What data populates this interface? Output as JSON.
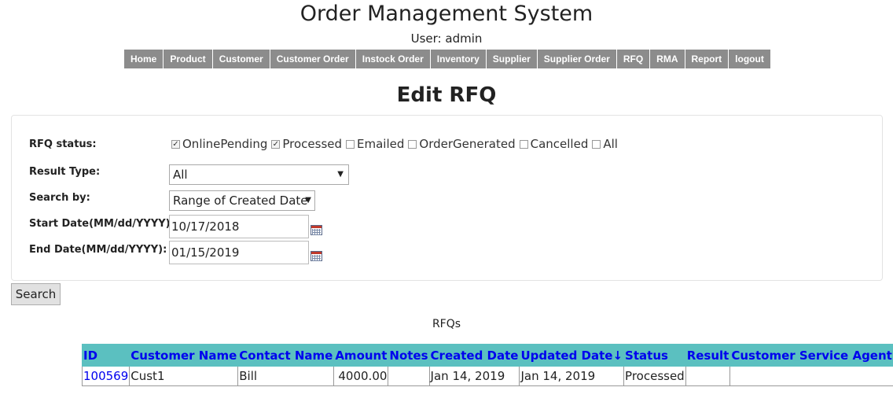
{
  "header": {
    "title": "Order Management System",
    "user_line": "User: admin"
  },
  "nav": {
    "items": [
      "Home",
      "Product",
      "Customer",
      "Customer Order",
      "Instock Order",
      "Inventory",
      "Supplier",
      "Supplier Order",
      "RFQ",
      "RMA",
      "Report",
      "logout"
    ]
  },
  "page": {
    "title": "Edit RFQ"
  },
  "form": {
    "status_label": "RFQ status:",
    "statuses": [
      {
        "label": "OnlinePending",
        "checked": true
      },
      {
        "label": "Processed",
        "checked": true
      },
      {
        "label": "Emailed",
        "checked": false
      },
      {
        "label": "OrderGenerated",
        "checked": false
      },
      {
        "label": "Cancelled",
        "checked": false
      },
      {
        "label": "All",
        "checked": false
      }
    ],
    "result_type_label": "Result Type:",
    "result_type_value": "All",
    "search_by_label": "Search by:",
    "search_by_value": "Range of Created Date",
    "start_date_label": "Start Date(MM/dd/YYYY):",
    "start_date_value": "10/17/2018",
    "end_date_label": "End Date(MM/dd/YYYY):",
    "end_date_value": "01/15/2019",
    "search_button": "Search",
    "dropdown_arrow": "▼"
  },
  "results": {
    "caption": "RFQs",
    "columns": [
      "ID",
      "Customer Name",
      "Contact Name",
      "Amount",
      "Notes",
      "Created Date",
      "Updated Date↓",
      "Status",
      "Result",
      "Customer Service Agent"
    ],
    "rows": [
      [
        "100569",
        "Cust1",
        "Bill",
        "4000.00",
        "",
        "Jan 14, 2019",
        "Jan 14, 2019",
        "Processed",
        "",
        ""
      ]
    ]
  },
  "colors": {
    "nav_bg": "#8c8c8c",
    "table_header_bg": "#5bc0c0",
    "link": "#0000ee"
  },
  "icons": {
    "calendar": "calendar-icon",
    "checkbox": "checkmark-icon"
  }
}
